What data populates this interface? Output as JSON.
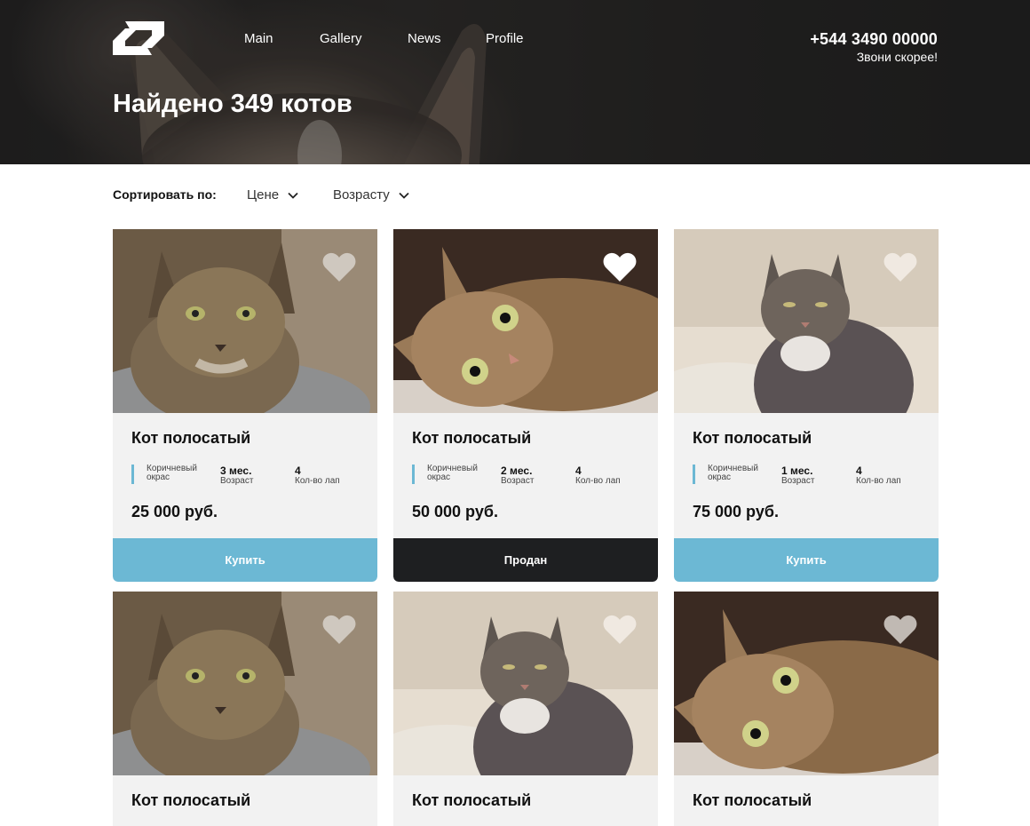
{
  "header": {
    "nav": [
      "Main",
      "Gallery",
      "News",
      "Profile"
    ],
    "phone": "+544 3490 00000",
    "phone_caption": "Звони скорее!",
    "title": "Найдено 349 котов"
  },
  "sort": {
    "label": "Сортировать по:",
    "options": [
      "Цене",
      "Возрасту"
    ]
  },
  "cards": [
    {
      "title": "Кот полосатый",
      "color_label": "Коричневый окрас",
      "age": "3 мес.",
      "age_label": "Возраст",
      "paws": "4",
      "paws_label": "Кол-во лап",
      "price": "25 000 руб.",
      "button": "Купить",
      "status": "available",
      "favorite": false
    },
    {
      "title": "Кот полосатый",
      "color_label": "Коричневый окрас",
      "age": "2 мес.",
      "age_label": "Возраст",
      "paws": "4",
      "paws_label": "Кол-во лап",
      "price": "50 000 руб.",
      "button": "Продан",
      "status": "sold",
      "favorite": true
    },
    {
      "title": "Кот полосатый",
      "color_label": "Коричневый окрас",
      "age": "1 мес.",
      "age_label": "Возраст",
      "paws": "4",
      "paws_label": "Кол-во лап",
      "price": "75 000 руб.",
      "button": "Купить",
      "status": "available",
      "favorite": false
    },
    {
      "title": "Кот полосатый",
      "favorite": false
    },
    {
      "title": "Кот полосатый",
      "favorite": false
    },
    {
      "title": "Кот полосатый",
      "favorite": false
    }
  ],
  "colors": {
    "accent": "#6cb8d4",
    "sold": "#1e1f21",
    "card_bg": "#f2f2f2",
    "header_bg": "#242322"
  }
}
